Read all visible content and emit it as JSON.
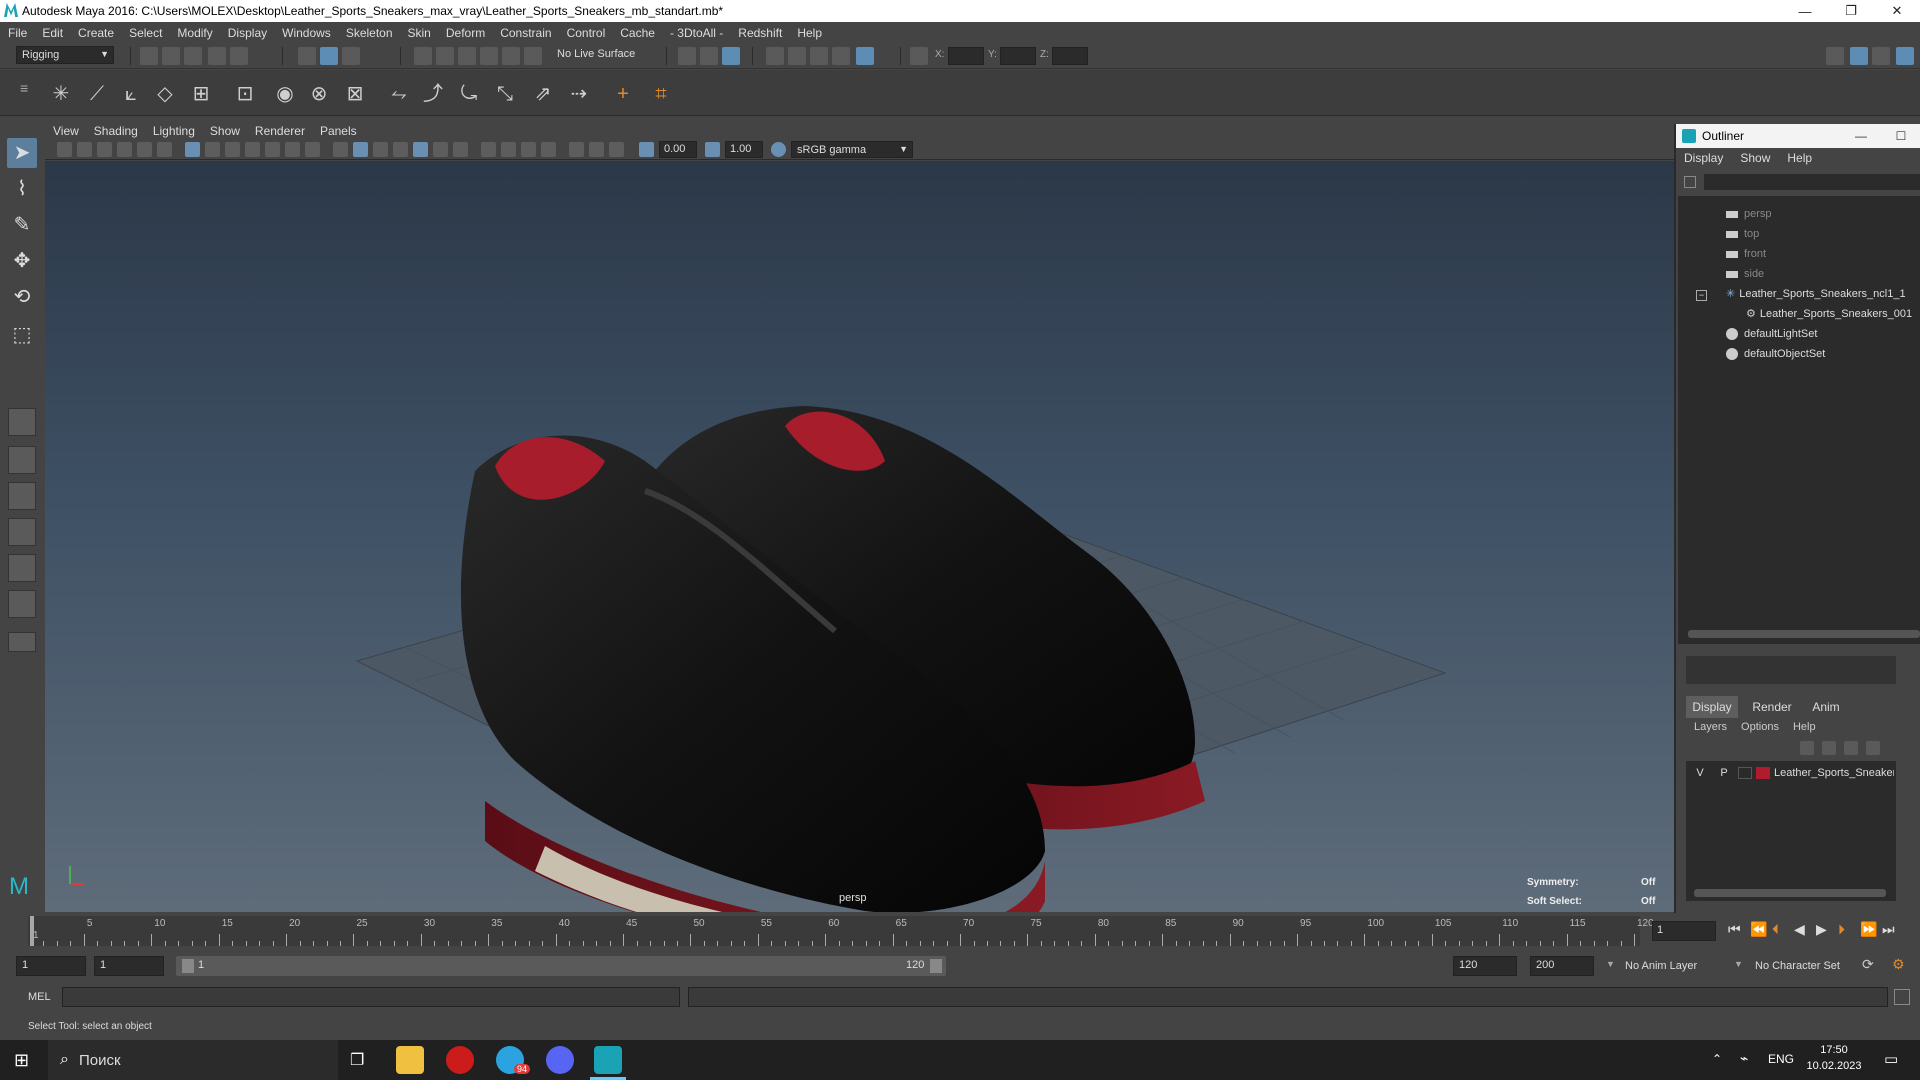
{
  "window": {
    "title": "Autodesk Maya 2016: C:\\Users\\MOLEX\\Desktop\\Leather_Sports_Sneakers_max_vray\\Leather_Sports_Sneakers_mb_standart.mb*",
    "minimize": "—",
    "restore": "❐",
    "close": "✕"
  },
  "menus": [
    "File",
    "Edit",
    "Create",
    "Select",
    "Modify",
    "Display",
    "Windows",
    "Skeleton",
    "Skin",
    "Deform",
    "Constrain",
    "Control",
    "Cache",
    "- 3DtoAll -",
    "Redshift",
    "Help"
  ],
  "status": {
    "menuset": "Rigging",
    "live_surface": "No Live Surface",
    "x_label": "X:",
    "y_label": "Y:",
    "z_label": "Z:"
  },
  "viewport": {
    "menus": [
      "View",
      "Shading",
      "Lighting",
      "Show",
      "Renderer",
      "Panels"
    ],
    "exposure": "0.00",
    "gamma": "1.00",
    "color_space": "sRGB gamma",
    "camera": "persp",
    "symmetry_label": "Symmetry:",
    "symmetry_value": "Off",
    "softselect_label": "Soft Select:",
    "softselect_value": "Off"
  },
  "outliner": {
    "title": "Outliner",
    "menus": [
      "Display",
      "Show",
      "Help"
    ],
    "items": [
      {
        "label": "persp"
      },
      {
        "label": "top"
      },
      {
        "label": "front"
      },
      {
        "label": "side"
      },
      {
        "label": "Leather_Sports_Sneakers_ncl1_1"
      },
      {
        "label": "Leather_Sports_Sneakers_001"
      },
      {
        "label": "defaultLightSet"
      },
      {
        "label": "defaultObjectSet"
      }
    ]
  },
  "channelbox": {
    "tabs": [
      "Display",
      "Render",
      "Anim"
    ],
    "menus": [
      "Layers",
      "Options",
      "Help"
    ],
    "layer": {
      "v": "V",
      "p": "P",
      "name": "Leather_Sports_Sneakers",
      "color": "#b01c2e"
    }
  },
  "timeline": {
    "labels": [
      "1",
      "5",
      "10",
      "15",
      "20",
      "25",
      "30",
      "35",
      "40",
      "45",
      "50",
      "55",
      "60",
      "65",
      "70",
      "75",
      "80",
      "85",
      "90",
      "95",
      "100",
      "105",
      "110",
      "115",
      "120"
    ],
    "current_frame": "1"
  },
  "range": {
    "start": "1",
    "inner_start": "1",
    "slider_start": "1",
    "slider_end": "120",
    "end": "120",
    "max": "200",
    "anim_layer": "No Anim Layer",
    "char_set": "No Character Set"
  },
  "cmd": {
    "label": "MEL"
  },
  "help_text": "Select Tool: select an object",
  "taskbar": {
    "search": "Поиск",
    "lang": "ENG",
    "time": "17:50",
    "date": "10.02.2023",
    "telegram_badge": "94"
  },
  "colors": {
    "accent": "#5d8db4",
    "layer_red": "#b01c2e"
  }
}
